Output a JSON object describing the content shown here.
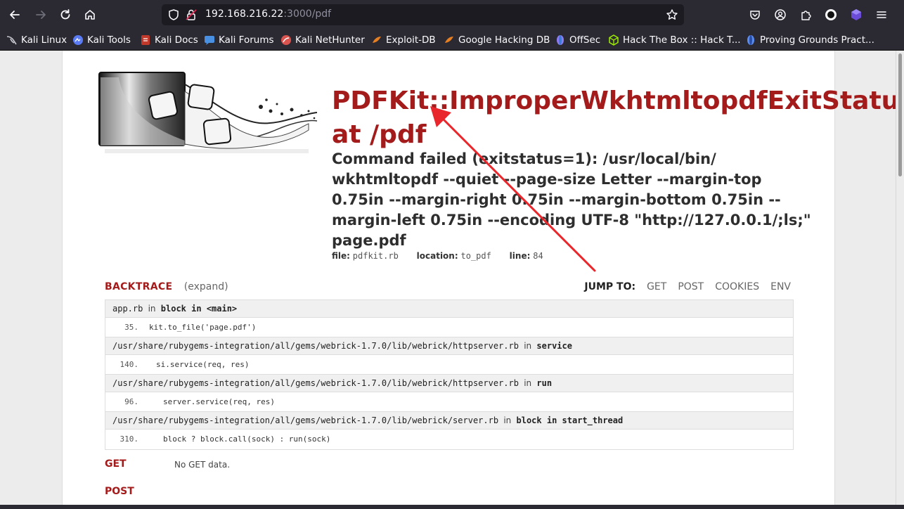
{
  "browser": {
    "url_host": "192.168.216.22",
    "url_rest": ":3000/pdf"
  },
  "bookmarks": [
    {
      "label": "Kali Linux",
      "icon": "kali-dragon-icon",
      "color": "#367bf0"
    },
    {
      "label": "Kali Tools",
      "icon": "kali-tools-icon",
      "color": "#5a7bf3"
    },
    {
      "label": "Kali Docs",
      "icon": "kali-docs-icon",
      "color": "#c0392b"
    },
    {
      "label": "Kali Forums",
      "icon": "kali-forums-icon",
      "color": "#4a90e2"
    },
    {
      "label": "Kali NetHunter",
      "icon": "nethunter-icon",
      "color": "#d9534f"
    },
    {
      "label": "Exploit-DB",
      "icon": "exploit-db-icon",
      "color": "#e67e22"
    },
    {
      "label": "Google Hacking DB",
      "icon": "ghdb-icon",
      "color": "#e67e22"
    },
    {
      "label": "OffSec",
      "icon": "offsec-icon",
      "color": "#8e7cf0"
    },
    {
      "label": "Hack The Box :: Hack T...",
      "icon": "htb-cube-icon",
      "color": "#9fef00"
    },
    {
      "label": "Proving Grounds Pract...",
      "icon": "proving-grounds-icon",
      "color": "#5b8def"
    }
  ],
  "error": {
    "title_line1": "PDFKit::ImproperWkhtmltopdfExitStatu",
    "title_line2": "at /pdf",
    "message": "Command failed (exitstatus=1): /usr/local/bin/ wkhtmltopdf --quiet --page-size Letter --margin-top 0.75in --margin-right 0.75in --margin-bottom 0.75in --margin-left 0.75in --encoding UTF-8 \"http://127.0.0.1/;ls;\" page.pdf",
    "file_label": "file:",
    "file_value": "pdfkit.rb",
    "location_label": "location:",
    "location_value": "to_pdf",
    "line_label": "line:",
    "line_value": "84"
  },
  "backtrace": {
    "label": "BACKTRACE",
    "expand": "(expand)",
    "jump_label": "JUMP TO:",
    "jump_links": [
      "GET",
      "POST",
      "COOKIES",
      "ENV"
    ],
    "frames": [
      {
        "file": "app.rb",
        "in": "in",
        "method_kw": "block in",
        "method": "<main>",
        "line": "35.",
        "code": "kit.to_file('page.pdf')"
      },
      {
        "file": "/usr/share/rubygems-integration/all/gems/webrick-1.7.0/lib/webrick/httpserver.rb",
        "in": "in",
        "method_kw": "",
        "method": "service",
        "line": "140.",
        "code": "si.service(req, res)"
      },
      {
        "file": "/usr/share/rubygems-integration/all/gems/webrick-1.7.0/lib/webrick/httpserver.rb",
        "in": "in",
        "method_kw": "",
        "method": "run",
        "line": "96.",
        "code": "server.service(req, res)"
      },
      {
        "file": "/usr/share/rubygems-integration/all/gems/webrick-1.7.0/lib/webrick/server.rb",
        "in": "in",
        "method_kw": "block in",
        "method": "start_thread",
        "line": "310.",
        "code": "block ? block.call(sock) : run(sock)"
      }
    ]
  },
  "sections": {
    "get_label": "GET",
    "get_note": "No GET data.",
    "post_label": "POST"
  },
  "colors": {
    "accent": "#a41b1b",
    "annotation_arrow": "#e8262b"
  }
}
